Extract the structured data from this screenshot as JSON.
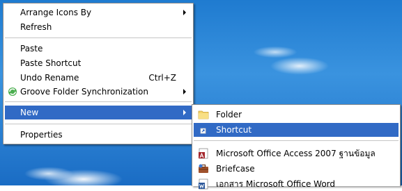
{
  "context_menu": {
    "items": [
      {
        "label": "Arrange Icons By",
        "submenu": true
      },
      {
        "label": "Refresh"
      },
      {
        "label": "Paste"
      },
      {
        "label": "Paste Shortcut"
      },
      {
        "label": "Undo Rename",
        "shortcut": "Ctrl+Z"
      },
      {
        "label": "Groove Folder Synchronization",
        "submenu": true,
        "icon": "groove-icon"
      },
      {
        "label": "New",
        "submenu": true,
        "highlighted": true
      },
      {
        "label": "Properties"
      }
    ]
  },
  "new_submenu": {
    "items": [
      {
        "label": "Folder",
        "icon": "folder-icon"
      },
      {
        "label": "Shortcut",
        "icon": "shortcut-icon",
        "highlighted": true
      },
      {
        "label": "Microsoft Office Access 2007 ฐานข้อมูล",
        "icon": "access-icon"
      },
      {
        "label": "Briefcase",
        "icon": "briefcase-icon"
      },
      {
        "label": "เอกสาร Microsoft Office Word",
        "icon": "word-icon"
      }
    ]
  },
  "colors": {
    "highlight": "#316ac5",
    "menu_background": "#ffffff",
    "desktop_sky": "#2b80d2"
  }
}
